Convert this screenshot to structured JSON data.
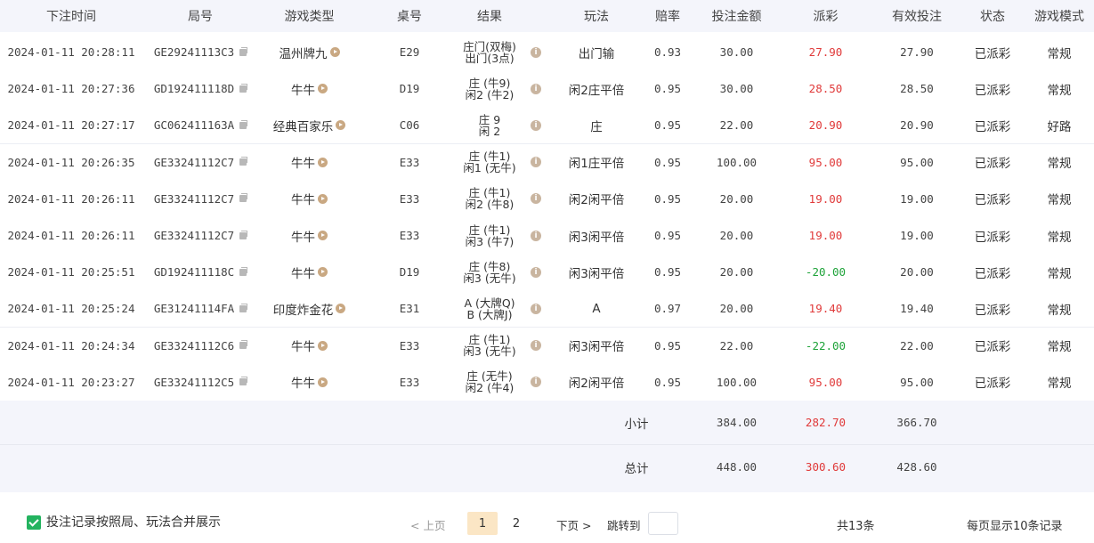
{
  "columns": [
    "下注时间",
    "局号",
    "游戏类型",
    "桌号",
    "结果",
    "玩法",
    "赔率",
    "投注金额",
    "派彩",
    "有效投注",
    "状态",
    "游戏模式"
  ],
  "rows": [
    {
      "time": "2024-01-11 20:28:11",
      "round": "GE29241113C3",
      "game": "温州牌九",
      "table": "E29",
      "result1": "庄门(双梅)",
      "result2": "出门(3点)",
      "play": "出门输",
      "odds": "0.93",
      "bet": "30.00",
      "payout": "27.90",
      "payout_color": "red",
      "valid": "27.90",
      "status": "已派彩",
      "mode": "常规"
    },
    {
      "time": "2024-01-11 20:27:36",
      "round": "GD192411118D",
      "game": "牛牛",
      "table": "D19",
      "result1": "庄 (牛9)",
      "result2": "闲2 (牛2)",
      "play": "闲2庄平倍",
      "odds": "0.95",
      "bet": "30.00",
      "payout": "28.50",
      "payout_color": "red",
      "valid": "28.50",
      "status": "已派彩",
      "mode": "常规"
    },
    {
      "time": "2024-01-11 20:27:17",
      "round": "GC062411163A",
      "game": "经典百家乐",
      "table": "C06",
      "result1": "庄 9",
      "result2": "闲 2",
      "play": "庄",
      "odds": "0.95",
      "bet": "22.00",
      "payout": "20.90",
      "payout_color": "red",
      "valid": "20.90",
      "status": "已派彩",
      "mode": "好路"
    },
    {
      "time": "2024-01-11 20:26:35",
      "round": "GE33241112C7",
      "game": "牛牛",
      "table": "E33",
      "result1": "庄 (牛1)",
      "result2": "闲1 (无牛)",
      "play": "闲1庄平倍",
      "odds": "0.95",
      "bet": "100.00",
      "payout": "95.00",
      "payout_color": "red",
      "valid": "95.00",
      "status": "已派彩",
      "mode": "常规"
    },
    {
      "time": "2024-01-11 20:26:11",
      "round": "GE33241112C7",
      "game": "牛牛",
      "table": "E33",
      "result1": "庄 (牛1)",
      "result2": "闲2 (牛8)",
      "play": "闲2闲平倍",
      "odds": "0.95",
      "bet": "20.00",
      "payout": "19.00",
      "payout_color": "red",
      "valid": "19.00",
      "status": "已派彩",
      "mode": "常规"
    },
    {
      "time": "2024-01-11 20:26:11",
      "round": "GE33241112C7",
      "game": "牛牛",
      "table": "E33",
      "result1": "庄 (牛1)",
      "result2": "闲3 (牛7)",
      "play": "闲3闲平倍",
      "odds": "0.95",
      "bet": "20.00",
      "payout": "19.00",
      "payout_color": "red",
      "valid": "19.00",
      "status": "已派彩",
      "mode": "常规"
    },
    {
      "time": "2024-01-11 20:25:51",
      "round": "GD192411118C",
      "game": "牛牛",
      "table": "D19",
      "result1": "庄 (牛8)",
      "result2": "闲3 (无牛)",
      "play": "闲3闲平倍",
      "odds": "0.95",
      "bet": "20.00",
      "payout": "-20.00",
      "payout_color": "green",
      "valid": "20.00",
      "status": "已派彩",
      "mode": "常规"
    },
    {
      "time": "2024-01-11 20:25:24",
      "round": "GE31241114FA",
      "game": "印度炸金花",
      "table": "E31",
      "result1": "A (大牌Q)",
      "result2": "B (大牌J)",
      "play": "A",
      "odds": "0.97",
      "bet": "20.00",
      "payout": "19.40",
      "payout_color": "red",
      "valid": "19.40",
      "status": "已派彩",
      "mode": "常规"
    },
    {
      "time": "2024-01-11 20:24:34",
      "round": "GE33241112C6",
      "game": "牛牛",
      "table": "E33",
      "result1": "庄 (牛1)",
      "result2": "闲3 (无牛)",
      "play": "闲3闲平倍",
      "odds": "0.95",
      "bet": "22.00",
      "payout": "-22.00",
      "payout_color": "green",
      "valid": "22.00",
      "status": "已派彩",
      "mode": "常规"
    },
    {
      "time": "2024-01-11 20:23:27",
      "round": "GE33241112C5",
      "game": "牛牛",
      "table": "E33",
      "result1": "庄 (无牛)",
      "result2": "闲2 (牛4)",
      "play": "闲2闲平倍",
      "odds": "0.95",
      "bet": "100.00",
      "payout": "95.00",
      "payout_color": "red",
      "valid": "95.00",
      "status": "已派彩",
      "mode": "常规"
    }
  ],
  "subtotal": {
    "label": "小计",
    "bet": "384.00",
    "payout": "282.70",
    "valid": "366.70"
  },
  "total": {
    "label": "总计",
    "bet": "448.00",
    "payout": "300.60",
    "valid": "428.60"
  },
  "footer": {
    "merge_label": "投注记录按照局、玩法合并展示",
    "merge_checked": true,
    "prev": "< 上页",
    "pages": [
      "1",
      "2"
    ],
    "current_page": "1",
    "next": "下页 >",
    "jump_label": "跳转到",
    "jump_value": "",
    "total_count": "共13条",
    "per_page": "每页显示10条记录"
  },
  "colors": {
    "red": "#e03a3a",
    "green": "#1fa33a",
    "accent": "#23b35f",
    "header_bg": "#f4f5fb",
    "active_page_bg": "#fbe6c5"
  }
}
